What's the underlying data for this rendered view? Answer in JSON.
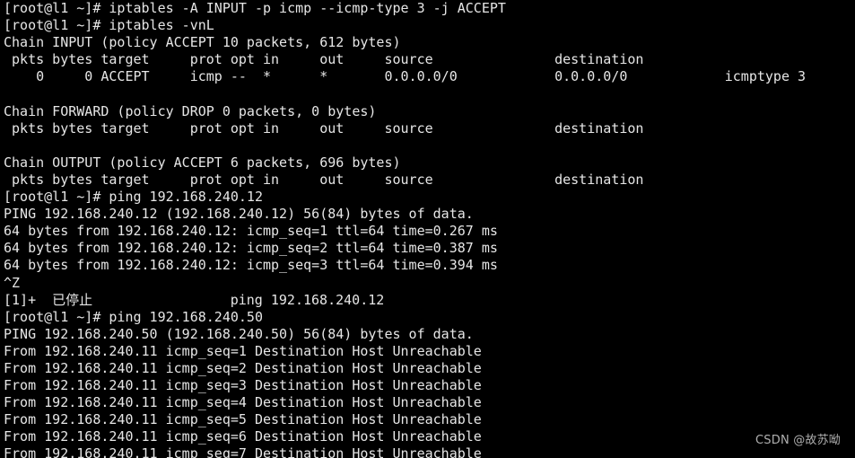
{
  "terminal": {
    "lines": [
      "[root@l1 ~]# iptables -A INPUT -p icmp --icmp-type 3 -j ACCEPT",
      "[root@l1 ~]# iptables -vnL",
      "Chain INPUT (policy ACCEPT 10 packets, 612 bytes)",
      " pkts bytes target     prot opt in     out     source               destination",
      "    0     0 ACCEPT     icmp --  *      *       0.0.0.0/0            0.0.0.0/0            icmptype 3",
      "",
      "Chain FORWARD (policy DROP 0 packets, 0 bytes)",
      " pkts bytes target     prot opt in     out     source               destination",
      "",
      "Chain OUTPUT (policy ACCEPT 6 packets, 696 bytes)",
      " pkts bytes target     prot opt in     out     source               destination",
      "[root@l1 ~]# ping 192.168.240.12",
      "PING 192.168.240.12 (192.168.240.12) 56(84) bytes of data.",
      "64 bytes from 192.168.240.12: icmp_seq=1 ttl=64 time=0.267 ms",
      "64 bytes from 192.168.240.12: icmp_seq=2 ttl=64 time=0.387 ms",
      "64 bytes from 192.168.240.12: icmp_seq=3 ttl=64 time=0.394 ms",
      "^Z",
      "[1]+  已停止                 ping 192.168.240.12",
      "[root@l1 ~]# ping 192.168.240.50",
      "PING 192.168.240.50 (192.168.240.50) 56(84) bytes of data.",
      "From 192.168.240.11 icmp_seq=1 Destination Host Unreachable",
      "From 192.168.240.11 icmp_seq=2 Destination Host Unreachable",
      "From 192.168.240.11 icmp_seq=3 Destination Host Unreachable",
      "From 192.168.240.11 icmp_seq=4 Destination Host Unreachable",
      "From 192.168.240.11 icmp_seq=5 Destination Host Unreachable",
      "From 192.168.240.11 icmp_seq=6 Destination Host Unreachable",
      "From 192.168.240.11 icmp_seq=7 Destination Host Unreachable"
    ]
  },
  "watermark": {
    "text": "CSDN @故苏呦"
  },
  "colors": {
    "background": "#000000",
    "text": "#e6e6e6"
  }
}
